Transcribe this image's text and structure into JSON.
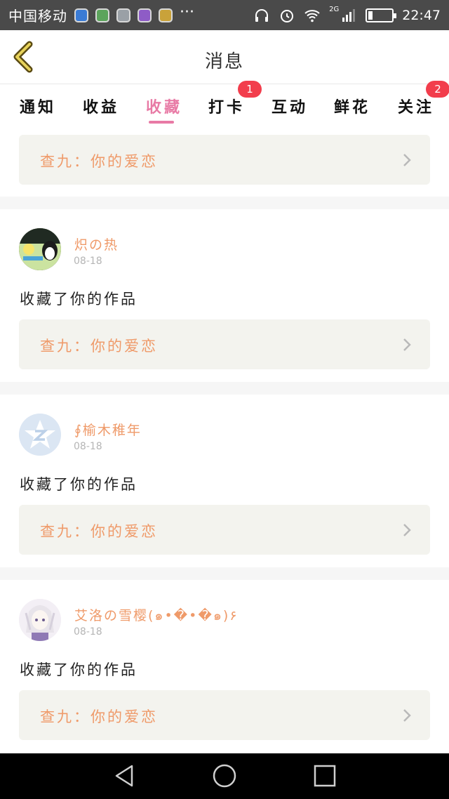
{
  "status_bar": {
    "carrier": "中国移动",
    "more": "···",
    "network": "2G",
    "time": "22:47"
  },
  "header": {
    "title": "消息"
  },
  "tabs": [
    {
      "label": "通知",
      "active": false
    },
    {
      "label": "收益",
      "active": false
    },
    {
      "label": "收藏",
      "active": true
    },
    {
      "label": "打卡",
      "active": false,
      "badge": "1"
    },
    {
      "label": "互动",
      "active": false
    },
    {
      "label": "鲜花",
      "active": false
    },
    {
      "label": "关注",
      "active": false,
      "badge": "2"
    }
  ],
  "items": [
    {
      "work": "查九：你的爱恋"
    },
    {
      "user": "炽の热",
      "date": "08-18",
      "action": "收藏了你的作品",
      "work": "查九：你的爱恋"
    },
    {
      "user": "∮榆木稚年",
      "date": "08-18",
      "action": "收藏了你的作品",
      "work": "查九：你的爱恋"
    },
    {
      "user": "艾洛の雪樱(๑•�•�๑)۶",
      "date": "08-18",
      "action": "收藏了你的作品",
      "work": "查九：你的爱恋"
    }
  ],
  "colors": {
    "accent_pink": "#e87aa5",
    "orange_text": "#ef9a69",
    "badge_red": "#f23d4c"
  },
  "icons": [
    "back-arrow-icon",
    "chevron-right-icon",
    "nav-back-icon",
    "nav-home-icon",
    "nav-recents-icon"
  ]
}
